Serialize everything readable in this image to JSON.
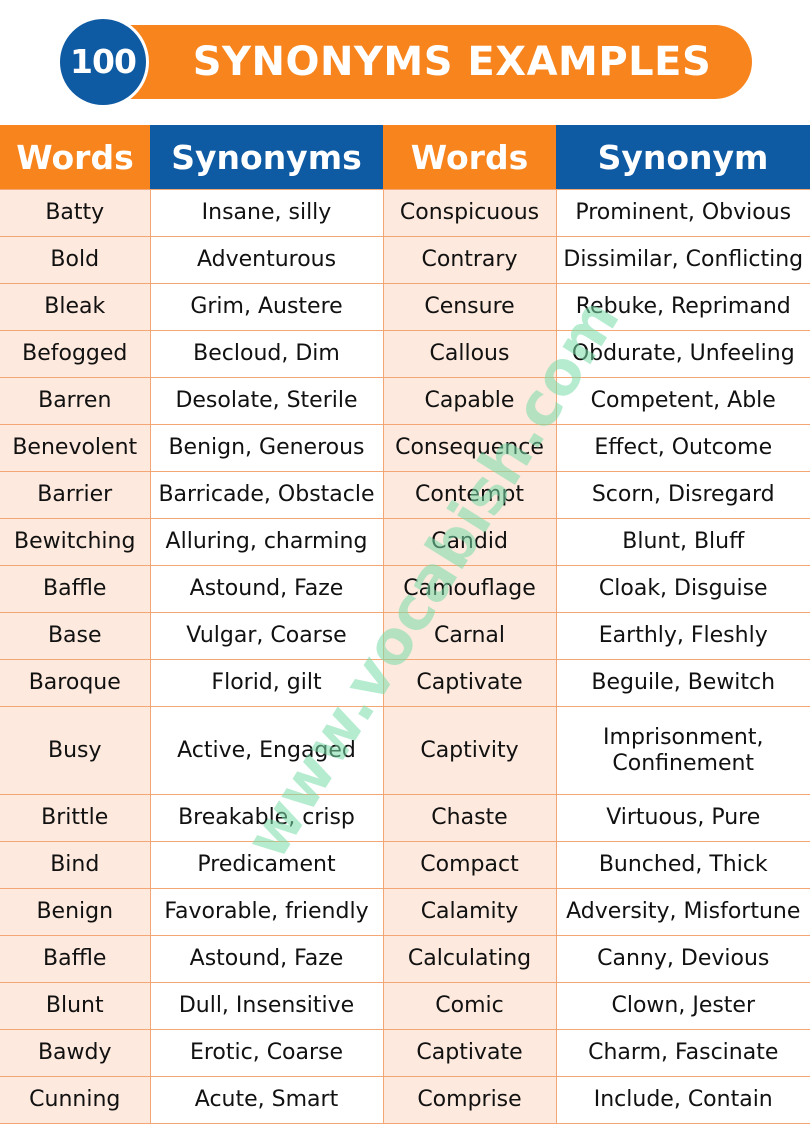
{
  "banner": {
    "badge": "100",
    "title": "SYNONYMS EXAMPLES"
  },
  "colors": {
    "orange": "#f7841d",
    "blue": "#0e5aa3",
    "word_cell_bg": "#fde9dd",
    "border": "#f4a774"
  },
  "table": {
    "headers": [
      "Words",
      "Synonyms",
      "Words",
      "Synonym"
    ],
    "rows": [
      [
        "Batty",
        "Insane, silly",
        "Conspicuous",
        "Prominent, Obvious"
      ],
      [
        "Bold",
        "Adventurous",
        "Contrary",
        "Dissimilar, Conflicting"
      ],
      [
        "Bleak",
        "Grim, Austere",
        "Censure",
        "Rebuke, Reprimand"
      ],
      [
        "Befogged",
        "Becloud, Dim",
        "Callous",
        "Obdurate, Unfeeling"
      ],
      [
        "Barren",
        "Desolate, Sterile",
        "Capable",
        "Competent, Able"
      ],
      [
        "Benevolent",
        "Benign, Generous",
        "Consequence",
        "Effect, Outcome"
      ],
      [
        "Barrier",
        "Barricade, Obstacle",
        "Contempt",
        "Scorn, Disregard"
      ],
      [
        "Bewitching",
        "Alluring, charming",
        "Candid",
        "Blunt, Bluff"
      ],
      [
        "Baffle",
        "Astound, Faze",
        "Camouflage",
        "Cloak, Disguise"
      ],
      [
        "Base",
        "Vulgar, Coarse",
        "Carnal",
        "Earthly, Fleshly"
      ],
      [
        "Baroque",
        "Florid, gilt",
        "Captivate",
        "Beguile, Bewitch"
      ],
      [
        "Busy",
        "Active, Engaged",
        "Captivity",
        "Imprisonment, Confinement"
      ],
      [
        "Brittle",
        "Breakable, crisp",
        "Chaste",
        "Virtuous, Pure"
      ],
      [
        "Bind",
        "Predicament",
        "Compact",
        "Bunched, Thick"
      ],
      [
        "Benign",
        "Favorable, friendly",
        "Calamity",
        "Adversity, Misfortune"
      ],
      [
        "Baffle",
        "Astound, Faze",
        "Calculating",
        "Canny, Devious"
      ],
      [
        "Blunt",
        "Dull, Insensitive",
        "Comic",
        "Clown, Jester"
      ],
      [
        "Bawdy",
        "Erotic, Coarse",
        "Captivate",
        "Charm, Fascinate"
      ],
      [
        "Cunning",
        "Acute, Smart",
        "Comprise",
        "Include, Contain"
      ]
    ]
  },
  "watermark": "www.vocabish.com"
}
